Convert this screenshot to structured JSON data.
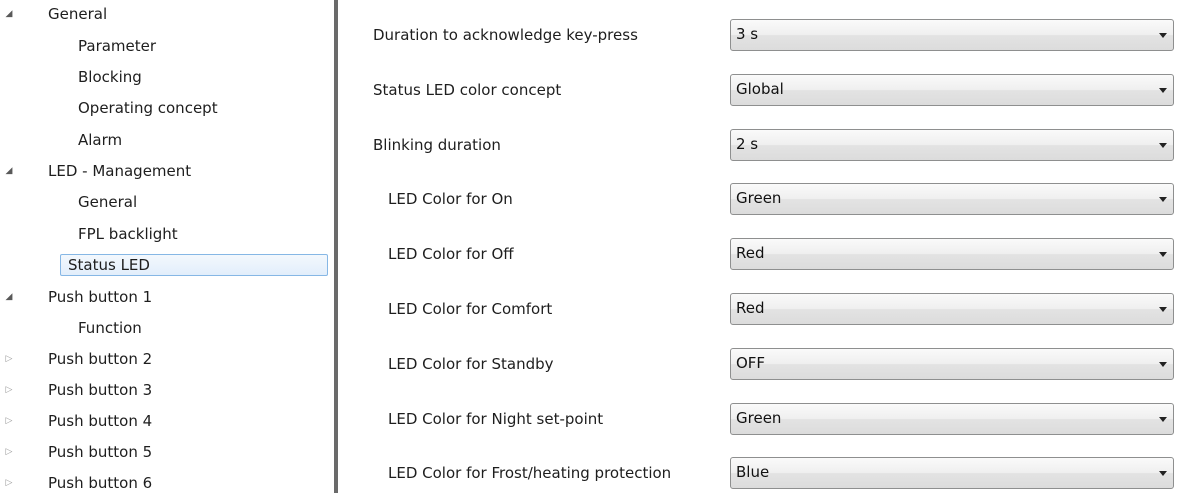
{
  "tree": {
    "items": [
      {
        "label": "General",
        "level": 0,
        "expander": "expanded"
      },
      {
        "label": "Parameter",
        "level": 1
      },
      {
        "label": "Blocking",
        "level": 1
      },
      {
        "label": "Operating concept",
        "level": 1
      },
      {
        "label": "Alarm",
        "level": 1
      },
      {
        "label": "LED - Management",
        "level": 0,
        "expander": "expanded"
      },
      {
        "label": "General",
        "level": 1
      },
      {
        "label": "FPL backlight",
        "level": 1
      },
      {
        "label": "Status LED",
        "level": 1,
        "selected": true
      },
      {
        "label": "Push button 1",
        "level": 0,
        "expander": "expanded"
      },
      {
        "label": "Function",
        "level": 1
      },
      {
        "label": "Push button 2",
        "level": 0,
        "expander": "collapsed"
      },
      {
        "label": "Push button 3",
        "level": 0,
        "expander": "collapsed"
      },
      {
        "label": "Push button 4",
        "level": 0,
        "expander": "collapsed"
      },
      {
        "label": "Push button 5",
        "level": 0,
        "expander": "collapsed"
      },
      {
        "label": "Push button 6",
        "level": 0,
        "expander": "collapsed"
      }
    ],
    "icons": {
      "expanded": "expanded-triangle-icon",
      "collapsed": "collapsed-triangle-icon"
    }
  },
  "parameters": [
    {
      "label": "Duration to acknowledge key-press",
      "value": "3 s",
      "indent": 0
    },
    {
      "label": "Status LED color concept",
      "value": "Global",
      "indent": 0
    },
    {
      "label": "Blinking duration",
      "value": "2 s",
      "indent": 0
    },
    {
      "label": "LED Color for On",
      "value": "Green",
      "indent": 1
    },
    {
      "label": "LED Color for Off",
      "value": "Red",
      "indent": 1
    },
    {
      "label": "LED Color for Comfort",
      "value": "Red",
      "indent": 1
    },
    {
      "label": "LED Color for Standby",
      "value": "OFF",
      "indent": 1
    },
    {
      "label": "LED Color for Night set-point",
      "value": "Green",
      "indent": 1
    },
    {
      "label": "LED Color for Frost/heating protection",
      "value": "Blue",
      "indent": 1
    }
  ],
  "colors": {
    "selection_border": "#86b7e5",
    "splitter": "#6a6a6a",
    "text": "#1e1e1e"
  }
}
